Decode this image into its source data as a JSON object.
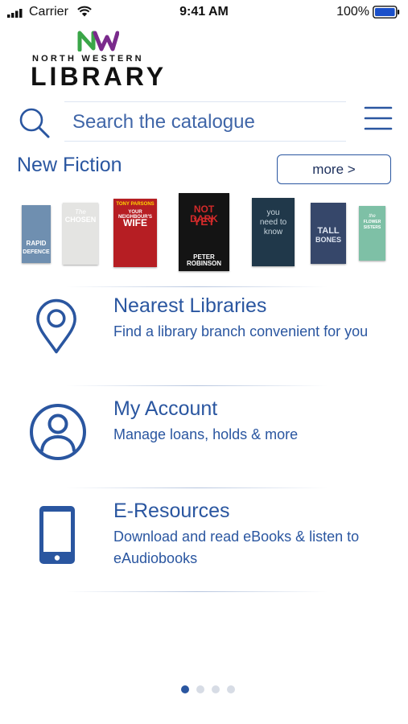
{
  "status_bar": {
    "carrier": "Carrier",
    "time": "9:41 AM",
    "battery_percent": "100%",
    "icons": [
      "signal-icon",
      "wifi-icon",
      "battery-icon"
    ]
  },
  "logo": {
    "mark": "NW",
    "line1": "NORTH WESTERN",
    "line2": "LIBRARY",
    "colors": {
      "green": "#3aa648",
      "purple": "#7a2a8c",
      "text": "#111111"
    }
  },
  "search": {
    "placeholder": "Search the catalogue",
    "icon": "search-icon",
    "menu_icon": "hamburger-menu-icon"
  },
  "new_fiction": {
    "title": "New Fiction",
    "more_label": "more >",
    "books": [
      {
        "line1": "RAPID",
        "line2": "DEFENCE",
        "line3": "",
        "bg": "#6f8fb0",
        "fg": "#ffffff"
      },
      {
        "line1": "The",
        "line2": "CHOSEN",
        "line3": "",
        "bg": "#e4e4e2",
        "fg": "#ffffff"
      },
      {
        "line1": "TONY PARSONS",
        "line2": "YOUR NEIGHBOUR'S",
        "line3": "WIFE",
        "bg": "#b61e23",
        "fg": "#ffffff"
      },
      {
        "line1": "NOT DARK",
        "line2": "YET",
        "line3": "PETER ROBINSON",
        "bg": "#141414",
        "fg": "#d22a2a"
      },
      {
        "line1": "you",
        "line2": "need to",
        "line3": "know",
        "bg": "#20384a",
        "fg": "#c9d6de"
      },
      {
        "line1": "TALL",
        "line2": "BONES",
        "line3": "",
        "bg": "#36476a",
        "fg": "#dfe6f2"
      },
      {
        "line1": "the",
        "line2": "FLOWER",
        "line3": "SISTERS",
        "bg": "#7ec0a6",
        "fg": "#ffffff"
      }
    ]
  },
  "menu": [
    {
      "title": "Nearest Libraries",
      "description": "Find a library branch convenient for you",
      "icon": "location-pin-icon"
    },
    {
      "title": "My Account",
      "description": "Manage loans, holds & more",
      "icon": "user-account-icon"
    },
    {
      "title": "E-Resources",
      "description": "Download and read eBooks & listen to eAudiobooks",
      "icon": "mobile-phone-icon"
    }
  ],
  "pagination": {
    "total": 4,
    "active": 1
  },
  "colors": {
    "primary": "#2a56a0",
    "dot_inactive": "#d7dce5"
  }
}
